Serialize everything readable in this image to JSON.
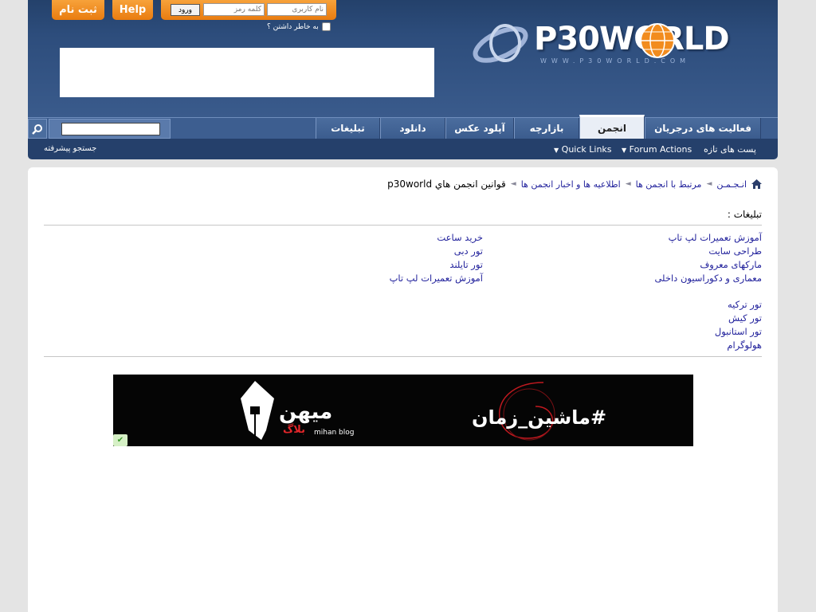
{
  "header": {
    "signup_label": "ثبت نام",
    "help_label": "Help",
    "login": {
      "username_placeholder": "نام کاربری",
      "password_placeholder": "کلمه رمز",
      "submit_label": "ورود",
      "remember_label": "به خاطر داشتن ؟"
    },
    "logo": {
      "text": "P30WORLD",
      "subtext": "WWW.P30WORLD.COM"
    }
  },
  "navbar": {
    "tabs": [
      {
        "label": "فعالیت های درجریان",
        "active": false
      },
      {
        "label": "انجمن",
        "active": true
      },
      {
        "label": "بازارچه",
        "active": false
      },
      {
        "label": "آپلود عکس",
        "active": false
      },
      {
        "label": "دانلود",
        "active": false
      },
      {
        "label": "تبلیغات",
        "active": false
      }
    ],
    "search_icon": "search-icon"
  },
  "subnav": {
    "new_posts": "پست های تازه",
    "forum_actions": "Forum Actions",
    "quick_links": "Quick Links",
    "advanced_search": "جستجو پیشرفته"
  },
  "breadcrumb": {
    "home_icon": "home-icon",
    "items": [
      "انـجـمـن",
      "مرتبط با انجمن ها",
      "اطلاعیه ها و اخبار انجمن ها"
    ],
    "current": "قوانین انجمن هاي p30world"
  },
  "ads": {
    "title": "تبلیغات :",
    "right_column": [
      "آموزش تعمیرات لپ تاپ",
      "طراحی سایت",
      "مارکهای معروف",
      "معماری و دکوراسیون داخلی"
    ],
    "left_column": [
      "خرید ساعت",
      "تور دبی",
      "تور تایلند",
      "آموزش تعمیرات لپ تاپ"
    ],
    "second_group": [
      "تور ترکیه",
      "تور کیش",
      "تور استانبول",
      "هولوگرام"
    ]
  },
  "banner": {
    "hashtag_text": "#ماشین_زمان",
    "mihan_text": "میهن",
    "balag_text": "بلاگ",
    "mihan_sub": "mihan blog"
  },
  "colors": {
    "header_blue": "#2d4d7c",
    "accent_orange": "#e97c10",
    "link_blue": "#22229c"
  }
}
